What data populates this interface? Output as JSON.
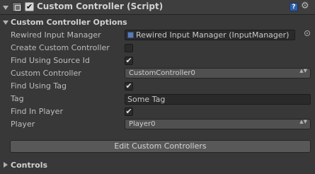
{
  "component": {
    "title": "Custom Controller (Script)",
    "enabled_check": "✔"
  },
  "icons": {
    "help": "?",
    "gear": "⚙",
    "fold_open": "chevron-down-icon",
    "fold_closed": "chevron-right-icon"
  },
  "options_section": {
    "title": "Custom Controller Options"
  },
  "fields": {
    "rewired_input_manager": {
      "label": "Rewired Input Manager",
      "value": "Rewired Input Manager (InputManager)"
    },
    "create_custom_controller": {
      "label": "Create Custom Controller",
      "checked": ""
    },
    "find_using_source_id": {
      "label": "Find Using Source Id",
      "checked": "✔"
    },
    "custom_controller": {
      "label": "Custom Controller",
      "value": "CustomController0"
    },
    "find_using_tag": {
      "label": "Find Using Tag",
      "checked": "✔"
    },
    "tag": {
      "label": "Tag",
      "value": "Some Tag"
    },
    "find_in_player": {
      "label": "Find In Player",
      "checked": "✔"
    },
    "player": {
      "label": "Player",
      "value": "Player0"
    }
  },
  "popup_arrows": "▲▼",
  "edit_button": {
    "label": "Edit Custom Controllers"
  },
  "controls_section": {
    "title": "Controls"
  }
}
